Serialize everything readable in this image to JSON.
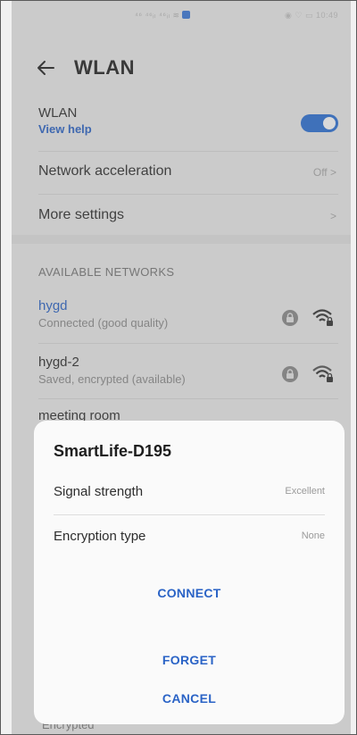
{
  "status_bar": {
    "left_text": "⁴⁶ ⁴⁶ᵢₗ ⁴⁶ᵢₗ ≋",
    "right_text": "◉ ♡ ▭ 10:49"
  },
  "header": {
    "title": "WLAN"
  },
  "wlan": {
    "label": "WLAN",
    "help_link": "View help",
    "enabled": true
  },
  "settings": {
    "acceleration_label": "Network acceleration",
    "acceleration_value": "Off >",
    "more_label": "More settings",
    "more_chevron": ">"
  },
  "networks": {
    "section_label": "AVAILABLE NETWORKS",
    "items": [
      {
        "name": "hygd",
        "status": "Connected (good quality)"
      },
      {
        "name": "hygd-2",
        "status": "Saved, encrypted (available)"
      },
      {
        "name": "meeting room"
      }
    ],
    "partial_status": "Encrypted"
  },
  "dialog": {
    "title": "SmartLife-D195",
    "rows": [
      {
        "label": "Signal strength",
        "value": "Excellent"
      },
      {
        "label": "Encryption type",
        "value": "None"
      }
    ],
    "connect_label": "CONNECT",
    "forget_label": "FORGET",
    "cancel_label": "CANCEL"
  },
  "colors": {
    "accent": "#2a63c6",
    "toggle_on": "#2a6fd4"
  }
}
